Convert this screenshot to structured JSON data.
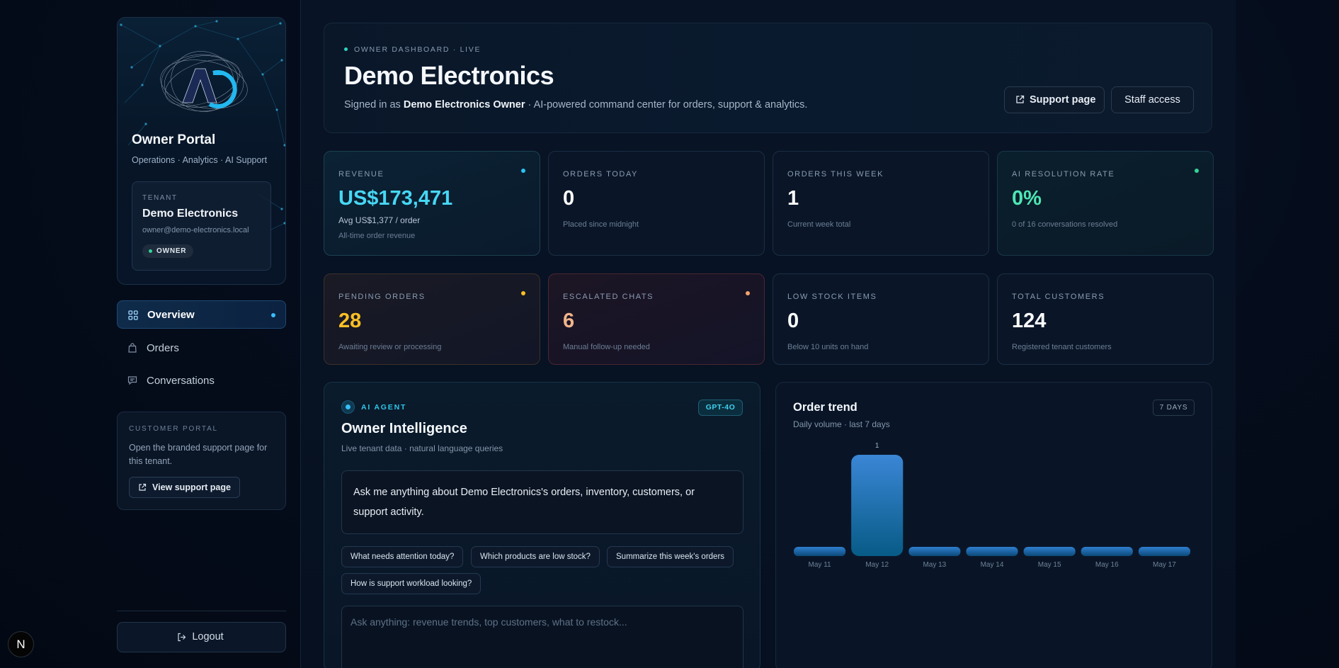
{
  "sidebar": {
    "brand_title": "Owner Portal",
    "brand_subtitle": "Operations · Analytics · AI Support",
    "tenant": {
      "label": "TENANT",
      "name": "Demo Electronics",
      "email": "owner@demo-electronics.local",
      "role": "OWNER"
    },
    "nav": [
      {
        "label": "Overview",
        "icon": "grid-icon",
        "active": true
      },
      {
        "label": "Orders",
        "icon": "bag-icon",
        "active": false
      },
      {
        "label": "Conversations",
        "icon": "chat-icon",
        "active": false
      }
    ],
    "portal": {
      "label": "CUSTOMER PORTAL",
      "description": "Open the branded support page for this tenant.",
      "button": "View support page"
    },
    "logout": "Logout",
    "next_badge": "N"
  },
  "header": {
    "kicker": "OWNER DASHBOARD · LIVE",
    "title": "Demo Electronics",
    "subtitle_prefix": "Signed in as ",
    "subtitle_user": "Demo Electronics Owner",
    "subtitle_suffix": " · AI-powered command center for orders, support & analytics.",
    "support_button": "Support page",
    "staff_button": "Staff access"
  },
  "metrics": {
    "revenue": {
      "label": "REVENUE",
      "value": "US$173,471",
      "note1": "Avg US$1,377 / order",
      "note2": "All-time order revenue",
      "color": "#47d7f4"
    },
    "orders_today": {
      "label": "ORDERS TODAY",
      "value": "0",
      "note": "Placed since midnight"
    },
    "orders_week": {
      "label": "ORDERS THIS WEEK",
      "value": "1",
      "note": "Current week total"
    },
    "ai_rate": {
      "label": "AI RESOLUTION RATE",
      "value": "0%",
      "note": "0 of 16 conversations resolved",
      "color": "#4ee6b4"
    },
    "pending": {
      "label": "PENDING ORDERS",
      "value": "28",
      "note": "Awaiting review or processing",
      "color": "#fbbf24"
    },
    "escalated": {
      "label": "ESCALATED CHATS",
      "value": "6",
      "note": "Manual follow-up needed",
      "color": "#f0b48a"
    },
    "low_stock": {
      "label": "LOW STOCK ITEMS",
      "value": "0",
      "note": "Below 10 units on hand"
    },
    "customers": {
      "label": "TOTAL CUSTOMERS",
      "value": "124",
      "note": "Registered tenant customers"
    }
  },
  "ai_panel": {
    "kicker": "AI AGENT",
    "model": "GPT-4O",
    "title": "Owner Intelligence",
    "subtitle": "Live tenant data · natural language queries",
    "message": "Ask me anything about Demo Electronics's orders, inventory, customers, or support activity.",
    "suggestions": [
      "What needs attention today?",
      "Which products are low stock?",
      "Summarize this week's orders",
      "How is support workload looking?"
    ],
    "input_placeholder": "Ask anything: revenue trends, top customers, what to restock..."
  },
  "trend": {
    "title": "Order trend",
    "subtitle": "Daily volume · last 7 days",
    "range": "7 DAYS"
  },
  "chart_data": {
    "type": "bar",
    "title": "Order trend",
    "categories": [
      "May 11",
      "May 12",
      "May 13",
      "May 14",
      "May 15",
      "May 16",
      "May 17"
    ],
    "values": [
      0,
      1,
      0,
      0,
      0,
      0,
      0
    ],
    "data_labels": [
      "",
      "1",
      "",
      "",
      "",
      "",
      ""
    ],
    "ylim": [
      0,
      1
    ],
    "bar_color": "#3b86d6"
  }
}
